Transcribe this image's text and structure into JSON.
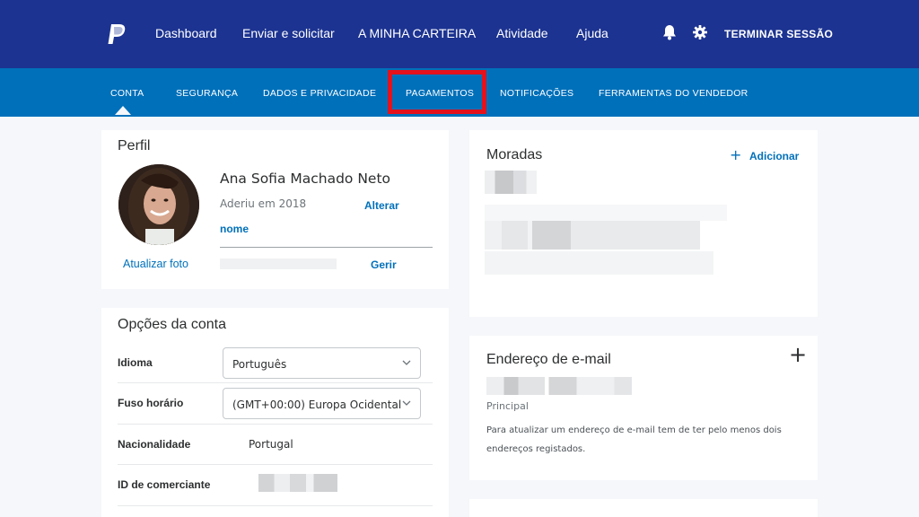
{
  "topnav": {
    "items": [
      "Dashboard",
      "Enviar e solicitar",
      "A MINHA CARTEIRA",
      "Atividade",
      "Ajuda"
    ],
    "logout": "TERMINAR SESSÃO"
  },
  "subnav": {
    "items": [
      "CONTA",
      "SEGURANÇA",
      "DADOS E PRIVACIDADE",
      "PAGAMENTOS",
      "NOTIFICAÇÕES",
      "FERRAMENTAS DO VENDEDOR"
    ],
    "active": "CONTA",
    "highlighted": "PAGAMENTOS"
  },
  "profile": {
    "title": "Perfil",
    "name": "Ana Sofia Machado Neto",
    "joined": "Aderiu em 2018",
    "change_name_1": "Alterar",
    "change_name_2": "nome",
    "update_photo": "Atualizar foto",
    "manage": "Gerir"
  },
  "account_options": {
    "title": "Opções da conta",
    "language_label": "Idioma",
    "language_value": "Português",
    "timezone_label": "Fuso horário",
    "timezone_value": "(GMT+00:00) Europa Ocidental",
    "nationality_label": "Nacionalidade",
    "nationality_value": "Portugal",
    "merchant_id_label": "ID de comerciante"
  },
  "addresses": {
    "title": "Moradas",
    "add": "Adicionar"
  },
  "email": {
    "title": "Endereço de e-mail",
    "primary": "Principal",
    "note_line1": "Para atualizar um endereço de e-mail tem de ter pelo menos dois",
    "note_line2": "endereços registados."
  },
  "colors": {
    "topbar": "#1c3391",
    "subbar": "#0070ba",
    "link": "#0070ba",
    "highlight": "#e4121c"
  },
  "icons": [
    "paypal-logo-icon",
    "bell-icon",
    "gear-icon",
    "chevron-down-icon",
    "plus-icon"
  ]
}
